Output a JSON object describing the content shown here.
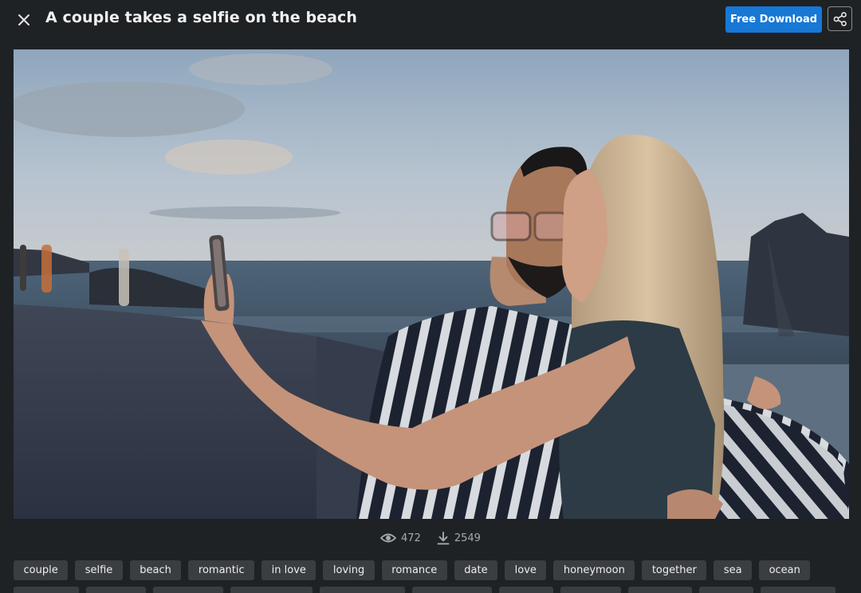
{
  "header": {
    "title": "A couple takes a selfie on the beach",
    "download_label": "Free Download",
    "icons": {
      "close": "close-icon",
      "share": "share-icon"
    }
  },
  "stats": {
    "views": "472",
    "downloads": "2549",
    "icons": {
      "views": "eye-icon",
      "downloads": "download-icon"
    }
  },
  "tags": [
    "couple",
    "selfie",
    "beach",
    "romantic",
    "in love",
    "loving",
    "romance",
    "date",
    "love",
    "honeymoon",
    "together",
    "sea",
    "ocean"
  ],
  "colors": {
    "background": "#1f2225",
    "accent": "#1778d6",
    "tag_bg": "#3a3d41"
  }
}
